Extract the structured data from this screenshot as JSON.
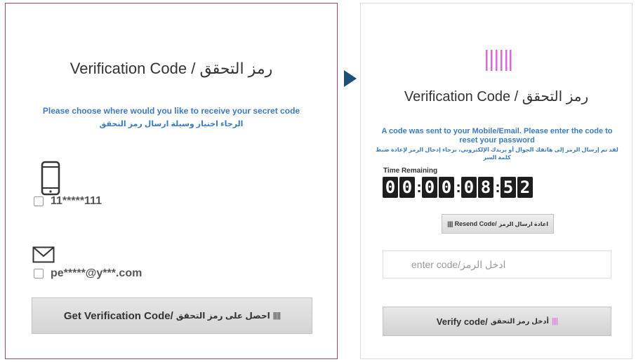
{
  "left": {
    "title": "Verification Code / رمز التحقق",
    "instruction_en": "Please choose where would you like to receive your secret code",
    "instruction_ar": "الرجاء اختيار وسيلة ارسال رمز التحقق",
    "options": [
      {
        "type": "mobile",
        "label": "11*****111",
        "checked": false
      },
      {
        "type": "email",
        "label": "pe*****@y***.com",
        "checked": false
      }
    ],
    "button_en": "Get Verification Code/",
    "button_ar": "احصل على رمز التحقق",
    "button_bars": "|||||"
  },
  "right": {
    "title": "Verification Code / رمز التحقق",
    "message_en": "A code was sent to your Mobile/Email. Please enter the code to reset your password",
    "message_ar": "لقد تم إرسال الرمز إلى هاتفك الجوال أو بريدك الإلكتروني، برجاء إدخال الرمز لإعادة ضبط كلمة السر",
    "time_label": "Time Remaining",
    "timer": {
      "hours": [
        "0",
        "0"
      ],
      "minutes": [
        "0",
        "8"
      ],
      "seconds": [
        "5",
        "2"
      ],
      "prefix": [
        "0",
        "0"
      ]
    },
    "resend_bars": "|||||",
    "resend_en": "Resend Code/",
    "resend_ar": "اعادة ارسال الرمز",
    "input_placeholder": "enter code/ادخل الرمز",
    "verify_en": "Verify code/",
    "verify_ar": "أدخل رمز التحقق",
    "verify_bars": "||||"
  },
  "colors": {
    "accent_blue": "#3a7bbf",
    "left_border": "#a0436a",
    "arrow": "#1f4e79",
    "logo_pink": "#d86ad8"
  }
}
